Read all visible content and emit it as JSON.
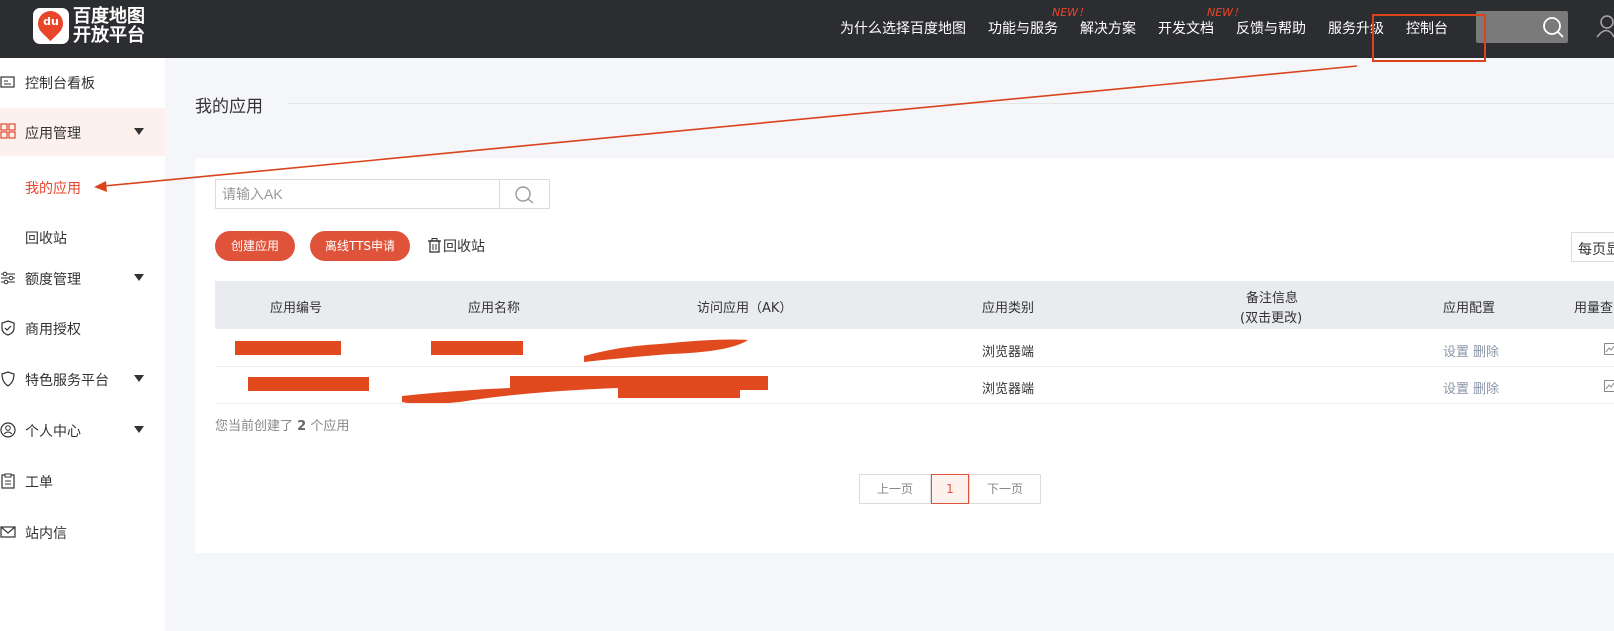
{
  "header": {
    "logo": {
      "badge": "du",
      "line1": "百度地图",
      "line2": "开放平台"
    },
    "nav": [
      {
        "label": "为什么选择百度地图",
        "badge": ""
      },
      {
        "label": "功能与服务",
        "badge": "NEW！"
      },
      {
        "label": "解决方案",
        "badge": ""
      },
      {
        "label": "开发文档",
        "badge": "NEW！"
      },
      {
        "label": "反馈与帮助",
        "badge": ""
      },
      {
        "label": "服务升级",
        "badge": ""
      },
      {
        "label": "控制台",
        "badge": ""
      }
    ]
  },
  "sidebar": {
    "items": [
      {
        "label": "控制台看板",
        "icon": "dashboard-icon"
      },
      {
        "label": "应用管理",
        "icon": "grid-icon"
      },
      {
        "label": "额度管理",
        "icon": "sliders-icon"
      },
      {
        "label": "商用授权",
        "icon": "shield-check-icon"
      },
      {
        "label": "特色服务平台",
        "icon": "heart-shield-icon"
      },
      {
        "label": "个人中心",
        "icon": "user-circle-icon"
      },
      {
        "label": "工单",
        "icon": "clipboard-icon"
      },
      {
        "label": "站内信",
        "icon": "mail-icon"
      }
    ],
    "sub": [
      "我的应用",
      "回收站"
    ]
  },
  "main": {
    "title": "我的应用",
    "search_placeholder": "请输入AK",
    "create_button": "创建应用",
    "tts_button": "离线TTS申请",
    "recycle_link": "回收站",
    "per_page": "每页显",
    "table": {
      "headers": [
        "应用编号",
        "应用名称",
        "访问应用（AK）",
        "应用类别",
        "备注信息",
        "(双击更改)",
        "应用配置",
        "用量查"
      ],
      "rows": [
        {
          "type": "浏览器端",
          "setting": "设置",
          "delete": "删除"
        },
        {
          "type": "浏览器端",
          "setting": "设置",
          "delete": "删除"
        }
      ]
    },
    "count": {
      "prefix": "您当前创建了",
      "num": "2",
      "suffix": "个应用"
    },
    "pagination": {
      "prev": "上一页",
      "current": "1",
      "next": "下一页"
    }
  },
  "colors": {
    "accent": "#e0533b",
    "topbar": "#2c2d30",
    "annotation": "#d9441c"
  }
}
